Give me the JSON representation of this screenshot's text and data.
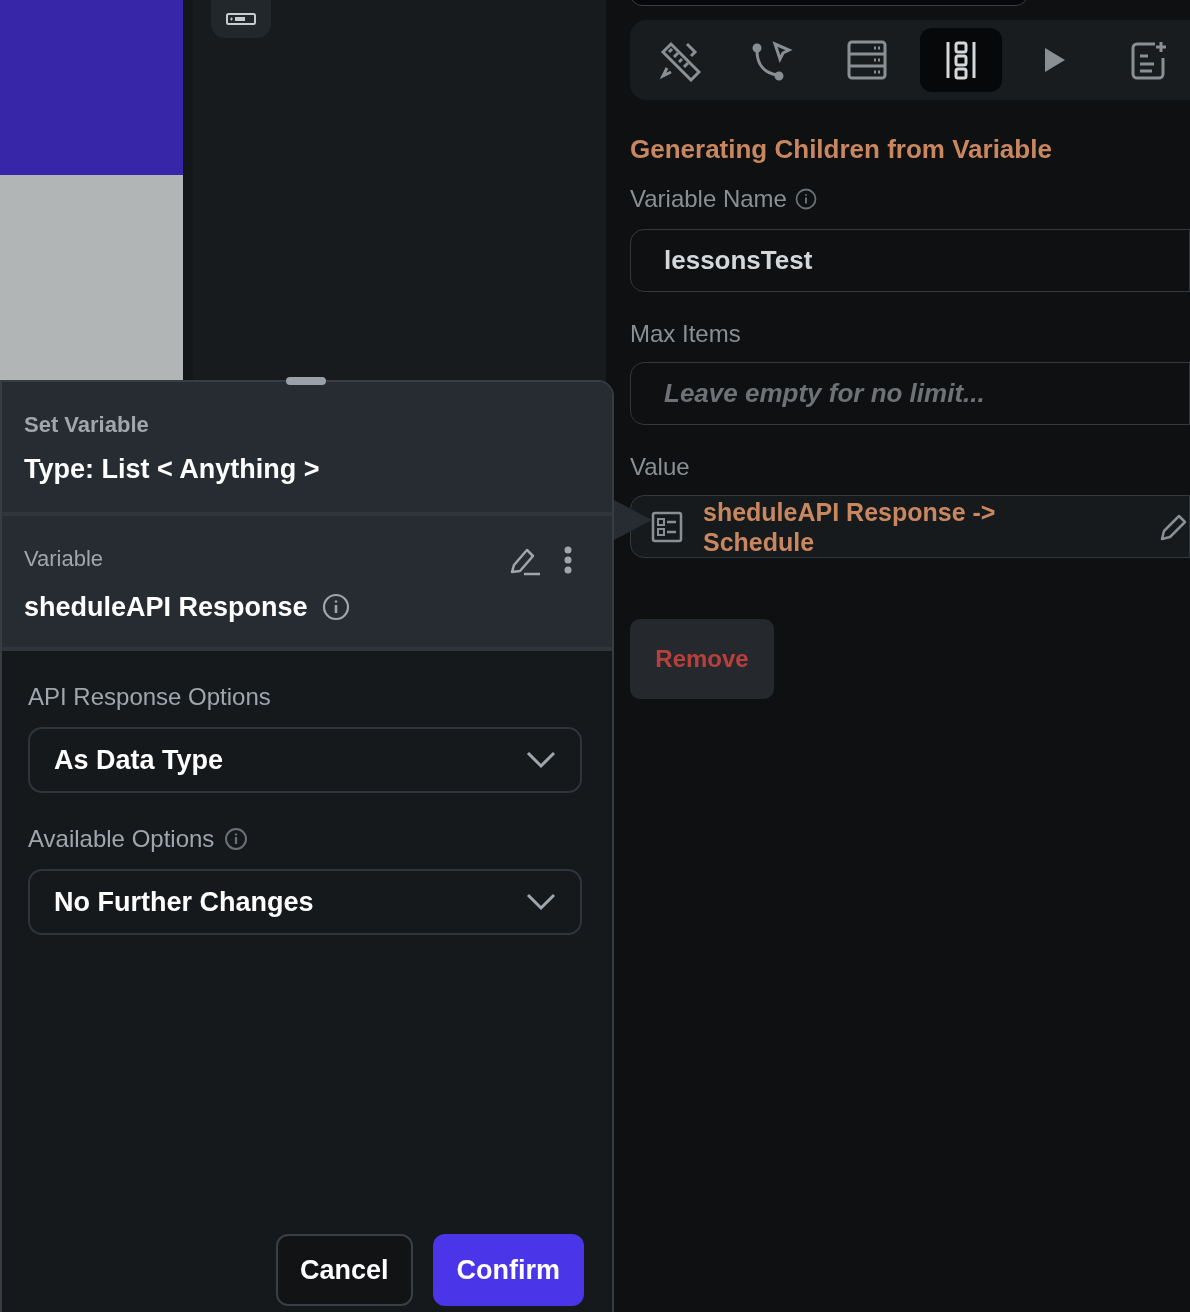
{
  "toolbar": [
    {
      "selected": false
    },
    {
      "selected": false
    },
    {
      "selected": false
    },
    {
      "selected": true
    },
    {
      "selected": false
    },
    {
      "selected": false
    }
  ],
  "section_title": "Generating Children from Variable",
  "variable_name": {
    "label": "Variable Name",
    "value": "lessonsTest"
  },
  "max_items": {
    "label": "Max Items",
    "placeholder": "Leave empty for no limit..."
  },
  "value": {
    "label": "Value",
    "text": "sheduleAPI Response -> Schedule"
  },
  "remove_button": "Remove",
  "popup": {
    "title": "Set Variable",
    "type": "Type: List < Anything >",
    "variable": {
      "label": "Variable",
      "name": "sheduleAPI Response"
    },
    "api_response_options": {
      "label": "API Response Options",
      "value": "As Data Type"
    },
    "available_options": {
      "label": "Available Options",
      "value": "No Further Changes"
    },
    "buttons": [
      {
        "label": "Cancel",
        "kind": "secondary"
      },
      {
        "label": "Confirm",
        "kind": "primary"
      }
    ]
  }
}
